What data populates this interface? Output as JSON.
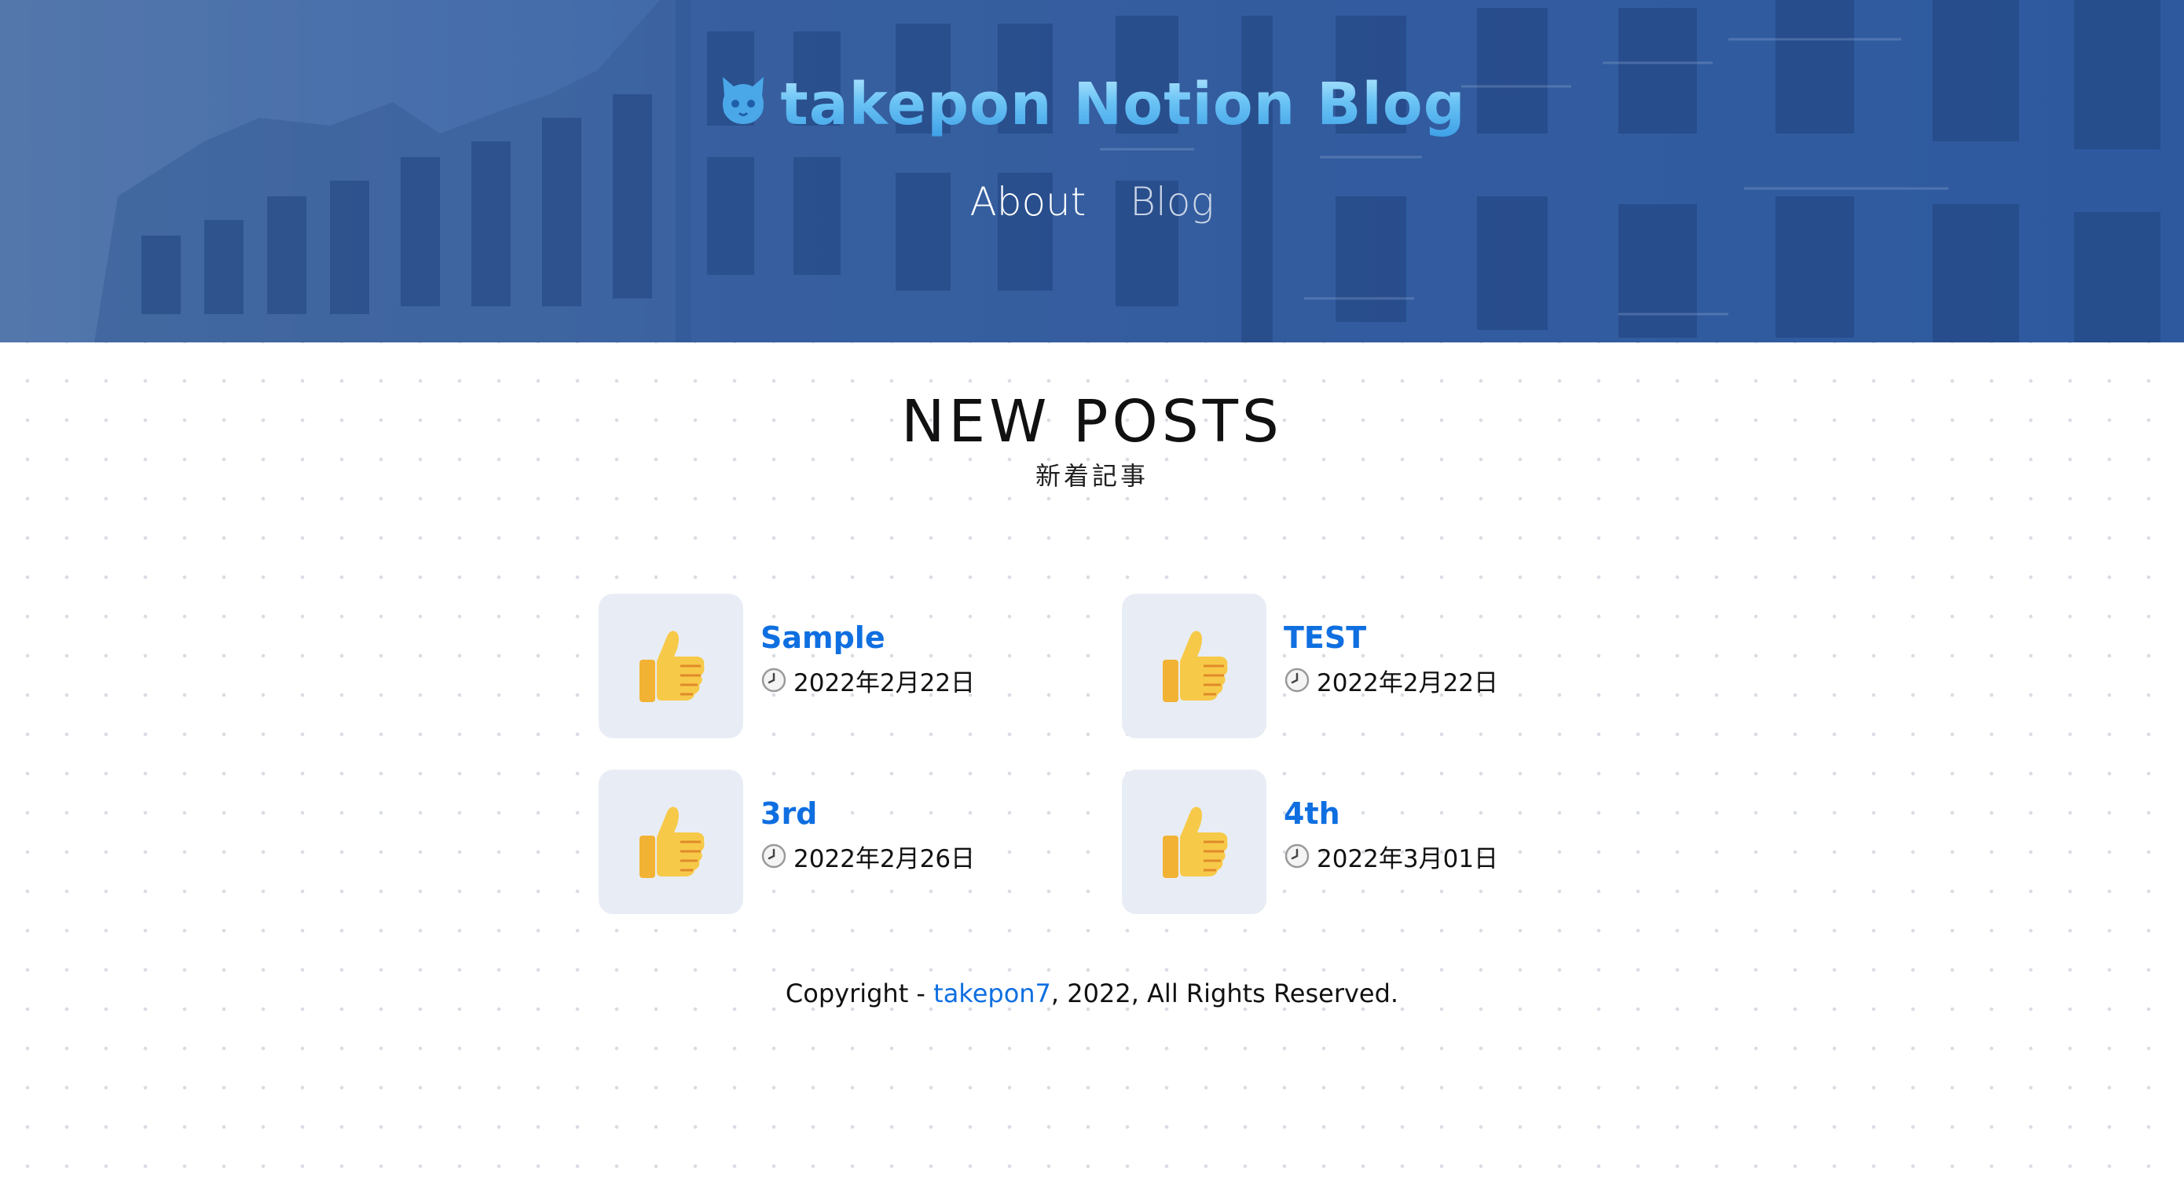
{
  "header": {
    "site_title": "takepon Notion Blog",
    "logo_icon": "cat-logo-icon",
    "nav": [
      {
        "label": "About"
      },
      {
        "label": "Blog"
      }
    ]
  },
  "main": {
    "heading": "NEW POSTS",
    "subheading": "新着記事",
    "posts": [
      {
        "title": "Sample",
        "date": "2022年2月22日",
        "thumbnail_icon": "thumbs-up-icon"
      },
      {
        "title": "TEST",
        "date": "2022年2月22日",
        "thumbnail_icon": "thumbs-up-icon"
      },
      {
        "title": "3rd",
        "date": "2022年2月26日",
        "thumbnail_icon": "thumbs-up-icon"
      },
      {
        "title": "4th",
        "date": "2022年3月01日",
        "thumbnail_icon": "thumbs-up-icon"
      }
    ]
  },
  "footer": {
    "prefix": "Copyright - ",
    "author_link": "takepon7",
    "suffix": ", 2022, All Rights Reserved."
  },
  "colors": {
    "hero_overlay": "#2f5ea7",
    "title_gradient_top": "#b7e8ff",
    "title_gradient_bottom": "#3d9fe6",
    "link_blue": "#0f6fe0",
    "thumbnail_bg": "#e8edf5"
  }
}
